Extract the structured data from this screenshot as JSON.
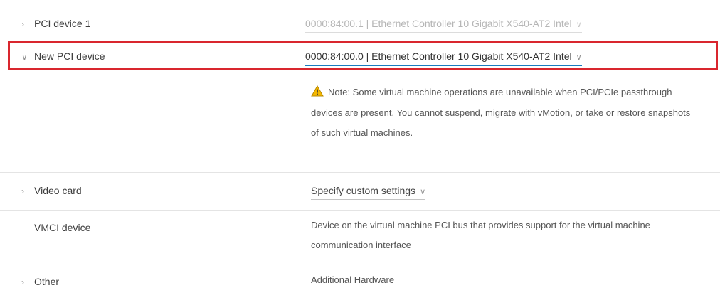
{
  "rows": {
    "pci1": {
      "label": "PCI device 1",
      "value": "0000:84:00.1 | Ethernet Controller 10 Gigabit X540-AT2 Intel"
    },
    "new_pci": {
      "label": "New PCI device",
      "value": "0000:84:00.0 | Ethernet Controller 10 Gigabit X540-AT2 Intel",
      "note": "Note: Some virtual machine operations are unavailable when PCI/PCIe passthrough devices are present. You cannot suspend, migrate with vMotion, or take or restore snapshots of such virtual machines."
    },
    "video": {
      "label": "Video card",
      "value": "Specify custom settings"
    },
    "vmci": {
      "label": "VMCI device",
      "value": "Device on the virtual machine PCI bus that provides support for the virtual machine communication interface"
    },
    "other": {
      "label": "Other",
      "value": "Additional Hardware"
    }
  },
  "icons": {
    "collapsed": "chevron-right-icon",
    "expanded": "chevron-down-icon",
    "dropdown": "dropdown-arrow-icon",
    "warning": "warning-icon"
  },
  "colors": {
    "highlight_border": "#d9262e",
    "active_underline": "#1a7cc0",
    "warning_fill": "#f5b800"
  }
}
